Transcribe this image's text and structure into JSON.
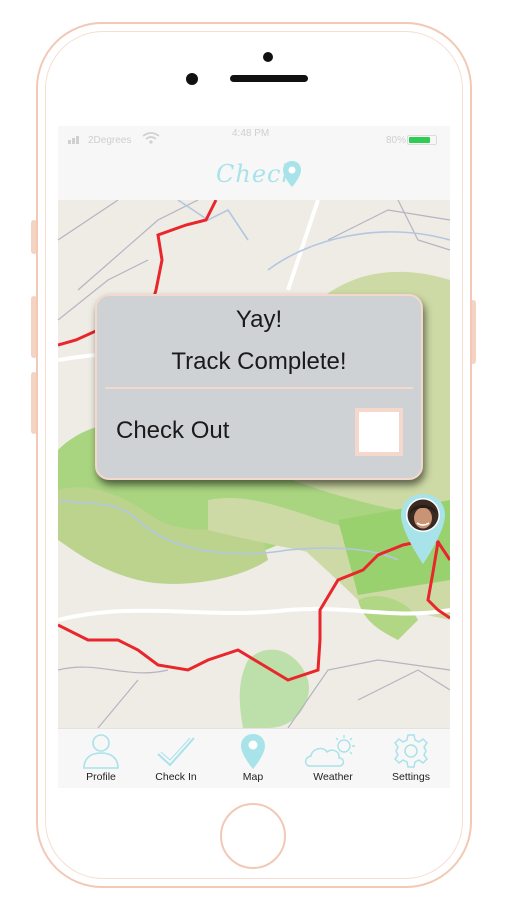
{
  "status_bar": {
    "carrier": "2Degrees",
    "time": "4:48 PM",
    "battery_pct": "80%",
    "battery_level": 0.8
  },
  "header": {
    "logo_text": "Check",
    "logo_icon": "map-pin-icon",
    "accent": "#a8e3ea"
  },
  "modal": {
    "title": "Yay!",
    "subtitle": "Track Complete!",
    "checkout_label": "Check Out",
    "checkbox_checked": false
  },
  "map": {
    "route_color": "#e8262c",
    "user_marker_icon": "user-location-pin-icon"
  },
  "tabbar": {
    "tabs": [
      {
        "label": "Profile",
        "icon": "person-icon"
      },
      {
        "label": "Check In",
        "icon": "checkmark-icon"
      },
      {
        "label": "Map",
        "icon": "map-pin-icon"
      },
      {
        "label": "Weather",
        "icon": "cloud-sun-icon"
      },
      {
        "label": "Settings",
        "icon": "gear-icon"
      }
    ]
  }
}
